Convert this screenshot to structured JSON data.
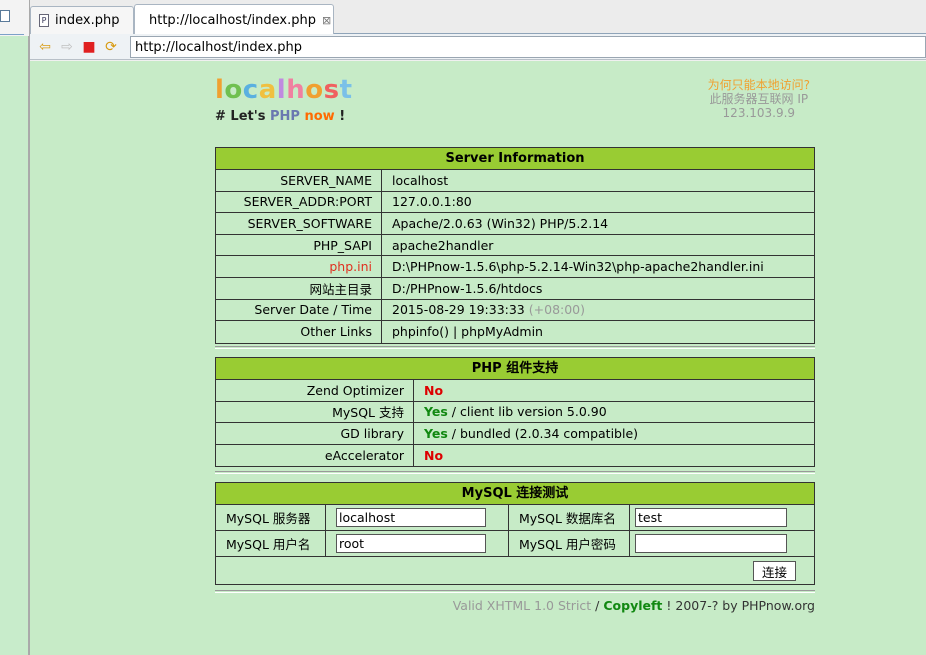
{
  "tabs": [
    {
      "label": "index.php",
      "icon": "php-file-icon"
    },
    {
      "label": "http://localhost/index.php",
      "icon": "globe-icon",
      "close": "⊠"
    }
  ],
  "toolbar": {
    "address": "http://localhost/index.php"
  },
  "header": {
    "logo_letters": [
      "l",
      "o",
      "c",
      "a",
      "l",
      "h",
      "o",
      "s",
      "t"
    ],
    "logo_colors": [
      "#f0a030",
      "#70c050",
      "#5ab0e0",
      "#f0c040",
      "#c08ae0",
      "#f080a0",
      "#f0a030",
      "#f06060",
      "#7ac0e8"
    ],
    "slogan_prefix": "# Let's",
    "slogan_php": "PHP",
    "slogan_now": "now",
    "slogan_suffix": "!",
    "ip_question": "为何只能本地访问?",
    "ip_label": "此服务器互联网 IP",
    "ip_value": "123.103.9.9"
  },
  "server_info": {
    "title": "Server Information",
    "rows": [
      {
        "key": "SERVER_NAME",
        "value": "localhost"
      },
      {
        "key": "SERVER_ADDR:PORT",
        "value": "127.0.0.1:80"
      },
      {
        "key": "SERVER_SOFTWARE",
        "value": "Apache/2.0.63 (Win32) PHP/5.2.14"
      },
      {
        "key": "PHP_SAPI",
        "value": "apache2handler"
      },
      {
        "key": "php.ini",
        "value": "D:\\PHPnow-1.5.6\\php-5.2.14-Win32\\php-apache2handler.ini"
      },
      {
        "key": "网站主目录",
        "value": "D:/PHPnow-1.5.6/htdocs"
      },
      {
        "key": "Server Date / Time",
        "value": "2015-08-29 19:33:33",
        "extra": "(+08:00)"
      },
      {
        "key": "Other Links",
        "value": "phpinfo() | phpMyAdmin"
      }
    ]
  },
  "php_components": {
    "title": "PHP 组件支持",
    "rows": [
      {
        "key": "Zend Optimizer",
        "status": "No",
        "detail": ""
      },
      {
        "key": "MySQL 支持",
        "status": "Yes",
        "detail": " / client lib version 5.0.90"
      },
      {
        "key": "GD library",
        "status": "Yes",
        "detail": " / bundled (2.0.34 compatible)"
      },
      {
        "key": "eAccelerator",
        "status": "No",
        "detail": ""
      }
    ]
  },
  "mysql_test": {
    "title": "MySQL 连接测试",
    "server_label": "MySQL 服务器",
    "server_value": "localhost",
    "db_label": "MySQL 数据库名",
    "db_value": "test",
    "user_label": "MySQL 用户名",
    "user_value": "root",
    "pass_label": "MySQL 用户密码",
    "pass_value": "",
    "connect_label": "连接"
  },
  "footer": {
    "valid": "Valid XHTML 1.0 Strict",
    "slash": " / ",
    "copyleft": "Copyleft",
    "rest": " ! 2007-? by PHPnow.org"
  }
}
